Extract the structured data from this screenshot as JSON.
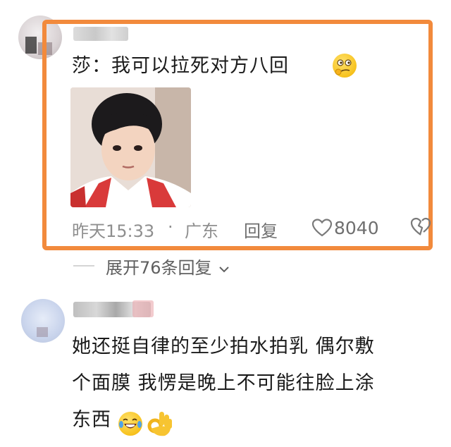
{
  "comment1": {
    "text": "莎：我可以拉死对方八回",
    "emoji": "thinking-emoji",
    "time": "昨天15:33",
    "separator": "·",
    "location": "广东",
    "reply_label": "回复",
    "like_count": "8040"
  },
  "replies": {
    "expand_label": "展开76条回复"
  },
  "comment2": {
    "text_line1": "她还挺自律的至少拍水拍乳 偶尔敷",
    "text_line2": "个面膜 我愣是晚上不可能往脸上涂",
    "text_line3": "东西",
    "emojis": [
      "laughing-crying-emoji",
      "ok-hand-emoji"
    ]
  },
  "colors": {
    "highlight": "#f28a3c",
    "meta_text": "#8f8f8f",
    "body_text": "#1b1b1b"
  }
}
